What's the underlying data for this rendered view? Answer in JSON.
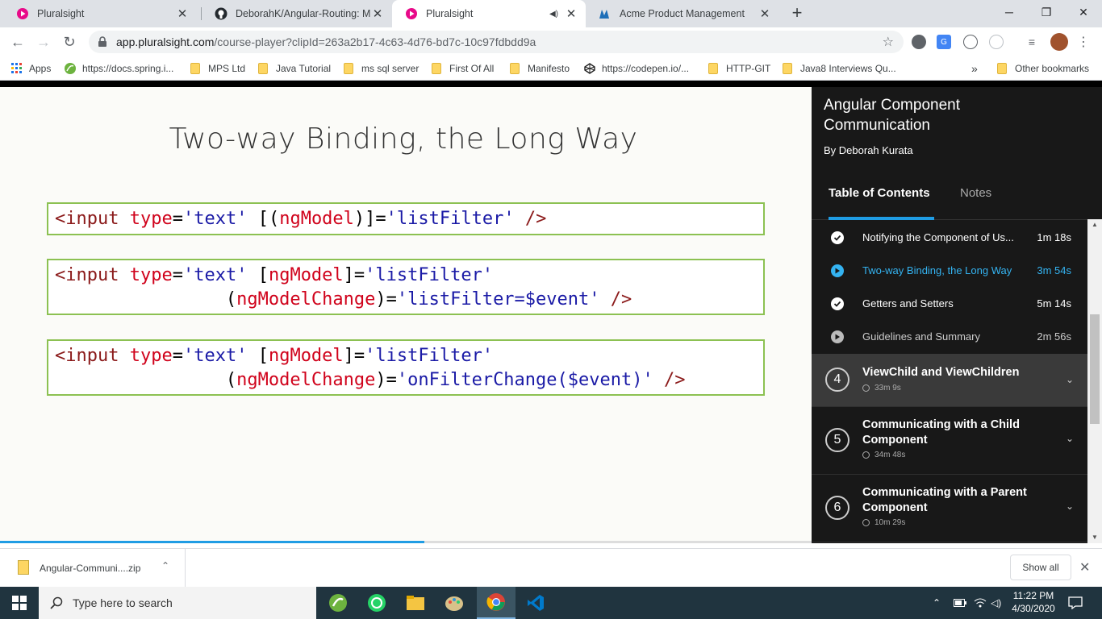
{
  "browser": {
    "tabs": [
      {
        "title": "Pluralsight",
        "active": false
      },
      {
        "title": "DeborahK/Angular-Routing: Mat",
        "active": false
      },
      {
        "title": "Pluralsight",
        "active": true
      },
      {
        "title": "Acme Product Management",
        "active": false
      }
    ],
    "new_tab": "+",
    "window": {
      "minimize": "─",
      "restore": "❐",
      "close": "✕"
    },
    "url_host": "app.pluralsight.com",
    "url_path": "/course-player?clipId=263a2b17-4c63-4d76-bd7c-10c97fdbdd9a",
    "bookmarks": [
      {
        "label": "Apps",
        "kind": "apps-icon"
      },
      {
        "label": "https://docs.spring.i...",
        "kind": "spring-icon"
      },
      {
        "label": "MPS Ltd",
        "kind": "folder-icon"
      },
      {
        "label": "Java Tutorial",
        "kind": "folder-icon"
      },
      {
        "label": "ms sql server",
        "kind": "folder-icon"
      },
      {
        "label": "First Of All",
        "kind": "folder-icon"
      },
      {
        "label": "Manifesto",
        "kind": "folder-icon"
      },
      {
        "label": "https://codepen.io/...",
        "kind": "codepen-icon"
      },
      {
        "label": "HTTP-GIT",
        "kind": "folder-icon"
      },
      {
        "label": "Java8 Interviews Qu...",
        "kind": "folder-icon"
      }
    ],
    "more_bookmarks": "»",
    "other_bookmarks": "Other bookmarks"
  },
  "slide": {
    "title": "Two-way Binding, the Long Way",
    "progress": 0.523
  },
  "sidebar": {
    "course_title": "Angular Component Communication",
    "author": "By Deborah Kurata",
    "tab_toc": "Table of Contents",
    "tab_notes": "Notes",
    "clips": [
      {
        "name": "Notifying the Component of Us...",
        "duration": "1m 18s",
        "state": "watched"
      },
      {
        "name": "Two-way Binding, the Long Way",
        "duration": "3m 54s",
        "state": "current"
      },
      {
        "name": "Getters and Setters",
        "duration": "5m 14s",
        "state": "watched"
      },
      {
        "name": "Guidelines and Summary",
        "duration": "2m 56s",
        "state": "unwatched"
      }
    ],
    "modules": [
      {
        "number": "4",
        "title": "ViewChild and ViewChildren",
        "duration": "33m 9s"
      },
      {
        "number": "5",
        "title": "Communicating with a Child Component",
        "duration": "34m 48s"
      },
      {
        "number": "6",
        "title": "Communicating with a Parent Component",
        "duration": "10m 29s"
      }
    ]
  },
  "downloads": {
    "file": "Angular-Communi....zip",
    "show_all": "Show all"
  },
  "taskbar": {
    "search_placeholder": "Type here to search",
    "time": "11:22 PM",
    "date": "4/30/2020"
  },
  "colors": {
    "accent": "#1f9ce4",
    "code_border": "#8cc152",
    "code_tag": "#8b1a1a",
    "code_attr": "#d0021b",
    "code_string": "#1a1aa6"
  }
}
